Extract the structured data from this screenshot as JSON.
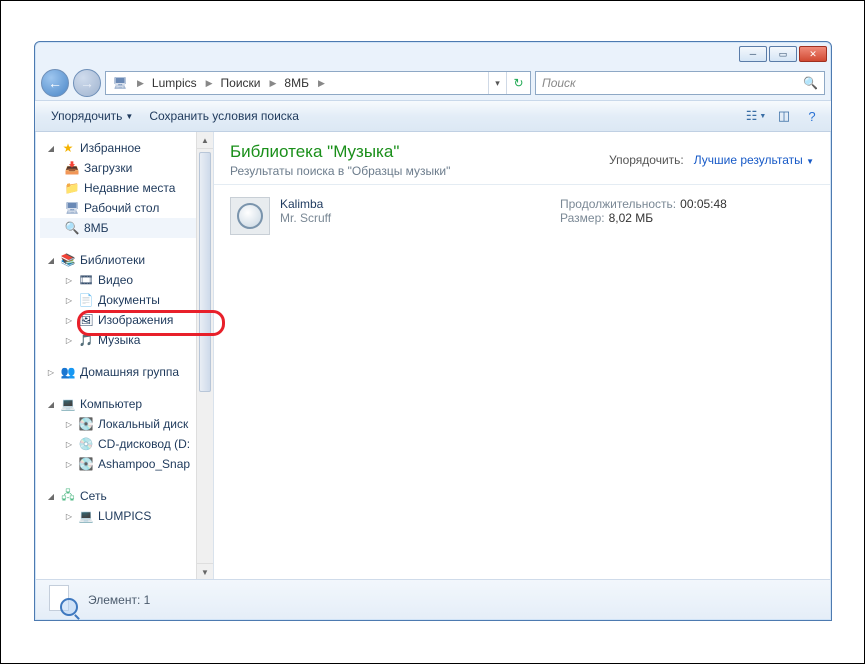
{
  "breadcrumb": {
    "seg1": "Lumpics",
    "seg2": "Поиски",
    "seg3": "8МБ"
  },
  "search": {
    "placeholder": "Поиск"
  },
  "toolbar": {
    "organize": "Упорядочить",
    "save_search": "Сохранить условия поиска"
  },
  "sidebar": {
    "favorites": {
      "label": "Избранное",
      "downloads": "Загрузки",
      "recent": "Недавние места",
      "desktop": "Рабочий стол",
      "search_8mb": "8МБ"
    },
    "libraries": {
      "label": "Библиотеки",
      "video": "Видео",
      "docs": "Документы",
      "images": "Изображения",
      "music": "Музыка"
    },
    "homegroup": {
      "label": "Домашняя группа"
    },
    "computer": {
      "label": "Компьютер",
      "local": "Локальный диск",
      "cd": "CD-дисковод (D:",
      "ash": "Ashampoo_Snap"
    },
    "network": {
      "label": "Сеть",
      "lumpics": "LUMPICS"
    }
  },
  "content": {
    "title": "Библиотека \"Музыка\"",
    "subtitle": "Результаты поиска в \"Образцы музыки\"",
    "sort_label": "Упорядочить:",
    "sort_value": "Лучшие результаты",
    "file": {
      "name": "Kalimba",
      "artist": "Mr. Scruff",
      "duration_k": "Продолжительность:",
      "duration_v": "00:05:48",
      "size_k": "Размер:",
      "size_v": "8,02 МБ"
    }
  },
  "status": {
    "label": "Элемент: 1"
  }
}
